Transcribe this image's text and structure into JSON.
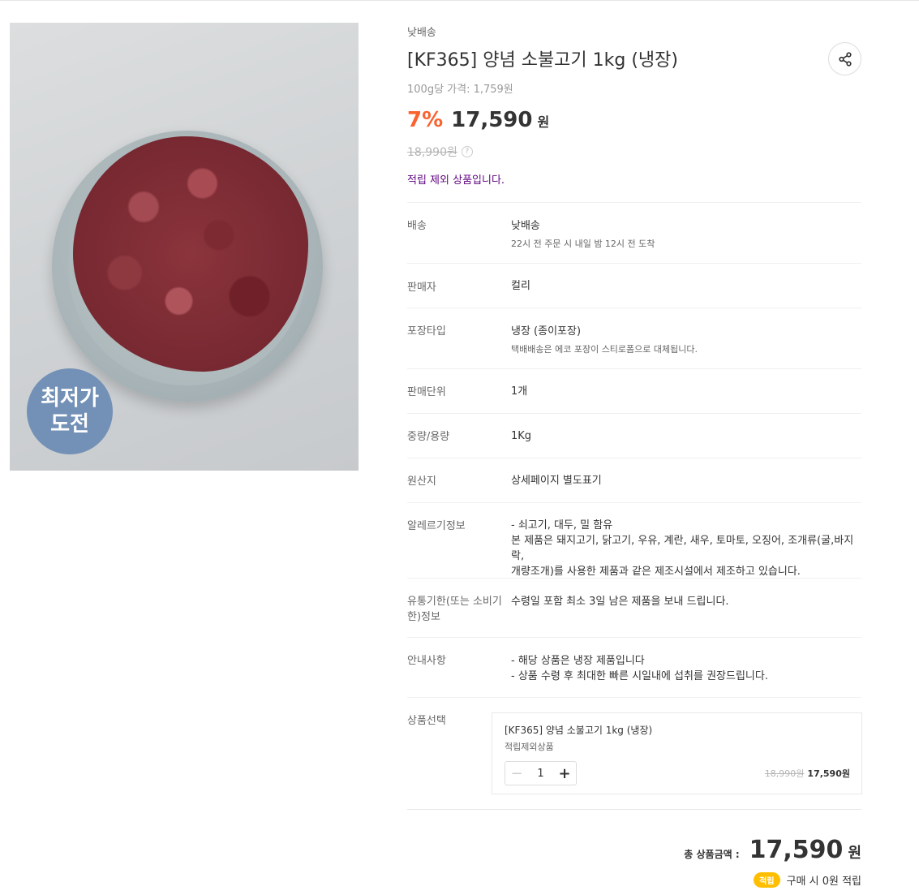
{
  "product": {
    "delivery_tag": "낮배송",
    "title": "[KF365] 양념 소불고기 1kg (냉장)",
    "unit_price": "100g당 가격: 1,759원",
    "discount_rate": "7%",
    "price": "17,590",
    "currency": "원",
    "original_price": "18,990원",
    "point_note": "적립 제외 상품입니다.",
    "badge_line1": "최저가",
    "badge_line2": "도전"
  },
  "details": {
    "delivery": {
      "label": "배송",
      "value": "낮배송",
      "sub": "22시 전 주문 시 내일 밤 12시 전 도착"
    },
    "seller": {
      "label": "판매자",
      "value": "컬리"
    },
    "packaging": {
      "label": "포장타입",
      "value": "냉장 (종이포장)",
      "sub": "택배배송은 에코 포장이 스티로폼으로 대체됩니다."
    },
    "sale_unit": {
      "label": "판매단위",
      "value": "1개"
    },
    "weight": {
      "label": "중량/용량",
      "value": "1Kg"
    },
    "origin": {
      "label": "원산지",
      "value": "상세페이지 별도표기"
    },
    "allergy": {
      "label": "알레르기정보",
      "lines": [
        "- 쇠고기, 대두, 밀 함유",
        "본 제품은 돼지고기, 닭고기, 우유, 계란, 새우, 토마토, 오징어, 조개류(굴,바지락,",
        "개량조개)를 사용한 제품과 같은 제조시설에서 제조하고 있습니다."
      ]
    },
    "expiry": {
      "label_line1": "유통기한(또는 소비기",
      "label_line2": "한)정보",
      "value": "수령일 포함 최소 3일 남은 제품을 보내 드립니다."
    },
    "notice": {
      "label": "안내사항",
      "lines": [
        "- 해당 상품은 냉장 제품입니다",
        "- 상품 수령 후 최대한 빠른 시일내에 섭취를 권장드립니다."
      ]
    },
    "option_label": "상품선택"
  },
  "option": {
    "name": "[KF365] 양념 소불고기 1kg (냉장)",
    "sub": "적립제외상품",
    "quantity": "1",
    "minus": "−",
    "plus": "+",
    "original_price": "18,990원",
    "price": "17,590원"
  },
  "total": {
    "label": "총 상품금액 :",
    "price": "17,590",
    "currency": "원",
    "accrual_badge": "적립",
    "accrual_text": "구매 시 0원 적립"
  },
  "colors": {
    "discount": "#fa622f",
    "point_note": "#5f0080",
    "badge_bg": "#7391b6",
    "accrual_badge": "#ffbf00"
  }
}
